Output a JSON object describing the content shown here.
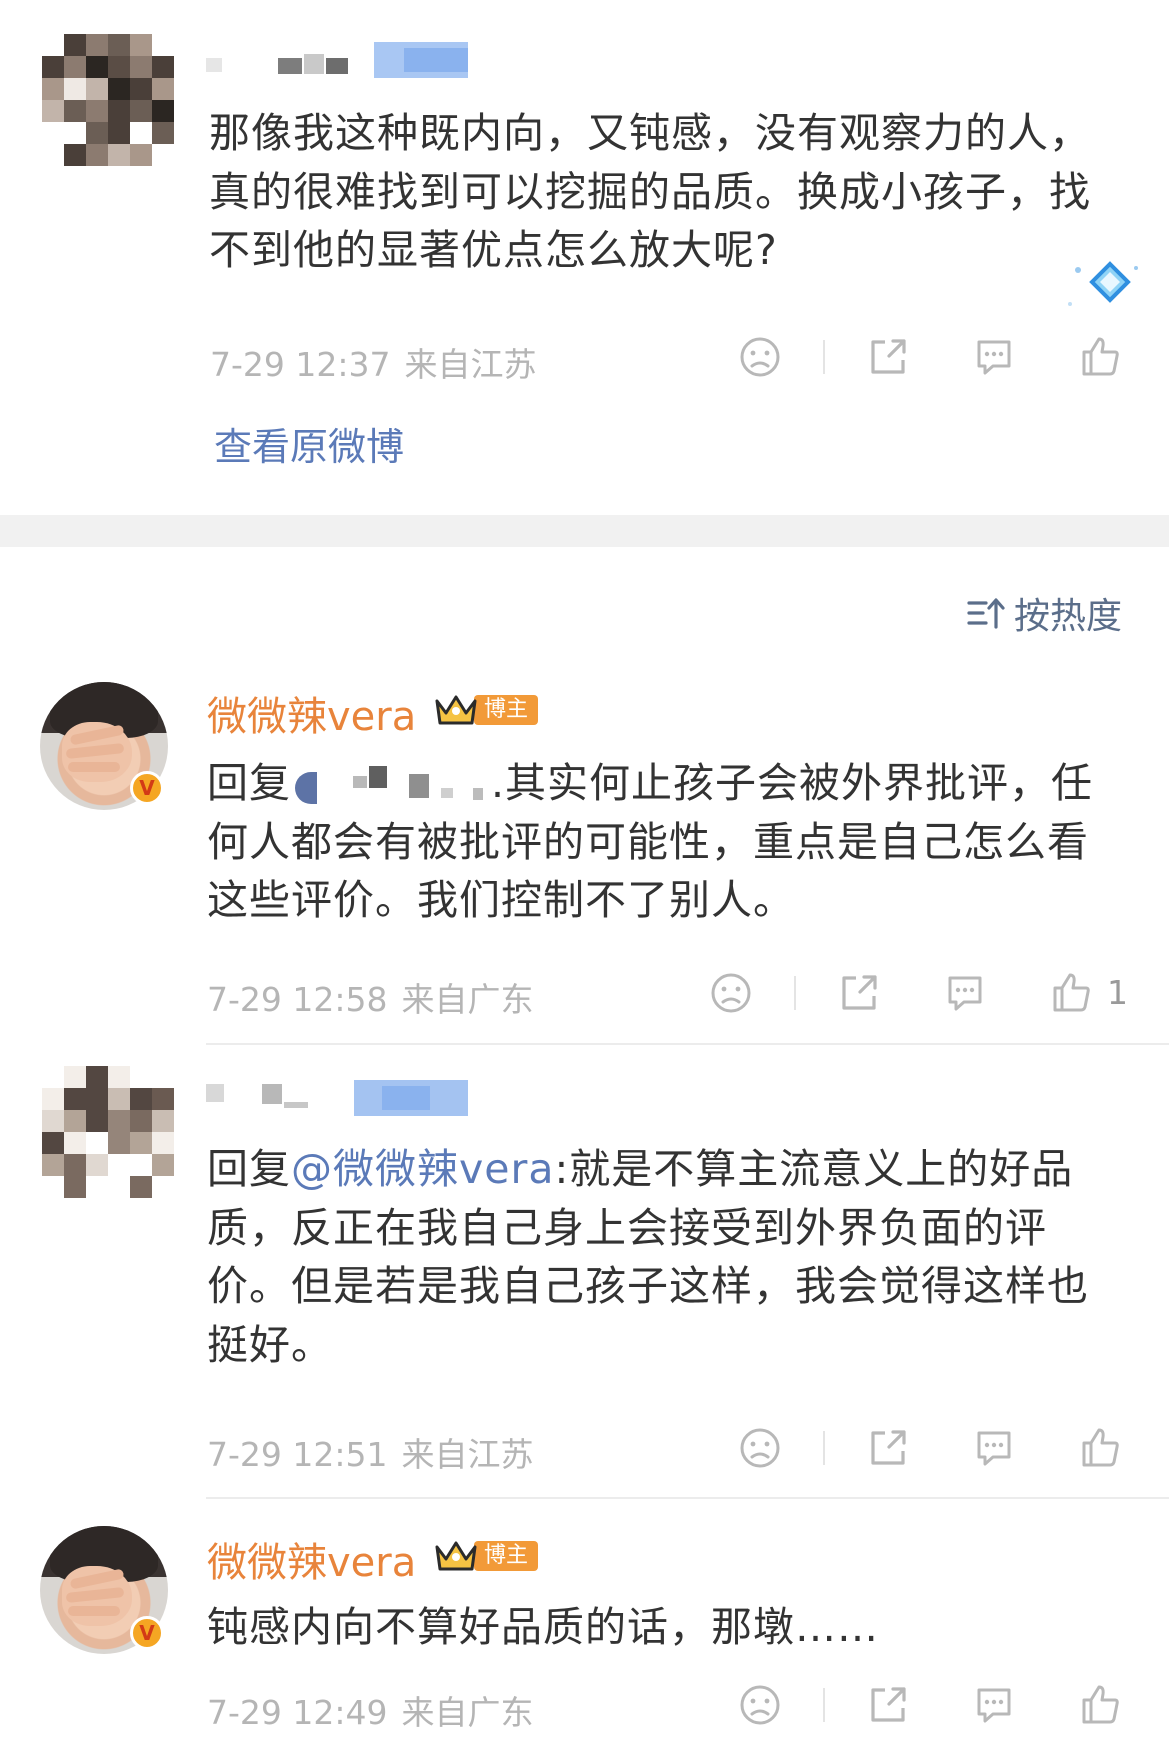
{
  "comments": [
    {
      "text": "那像我这种既内向，又钝感，没有观察力的人，真的很难找到可以挖掘的品质。换成小孩子，找不到他的显著优点怎么放大呢?",
      "time": "7-29 12:37",
      "location": "来自江苏"
    },
    {
      "nickname": "微微辣vera",
      "badge": "博主",
      "reply_prefix": "回复",
      "text": ".其实何止孩子会被外界批评，任何人都会有被批评的可能性，重点是自己怎么看这些评价。我们控制不了别人。",
      "time": "7-29 12:58",
      "location": "来自广东",
      "likes": "1"
    },
    {
      "reply_prefix": "回复",
      "mention": "@微微辣vera",
      "text": ":就是不算主流意义上的好品质，反正在我自己身上会接受到外界负面的评价。但是若是我自己孩子这样，我会觉得这样也挺好。",
      "time": "7-29 12:51",
      "location": "来自江苏"
    },
    {
      "nickname": "微微辣vera",
      "badge": "博主",
      "text": "钝感内向不算好品质的话，那墩……",
      "time": "7-29 12:49",
      "location": "来自广东"
    }
  ],
  "view_original": "查看原微博",
  "sort_label": "按热度",
  "colors": {
    "nickname": "#e8843b",
    "link": "#5b7ab8",
    "meta": "#b5b5b5",
    "text": "#333333"
  }
}
